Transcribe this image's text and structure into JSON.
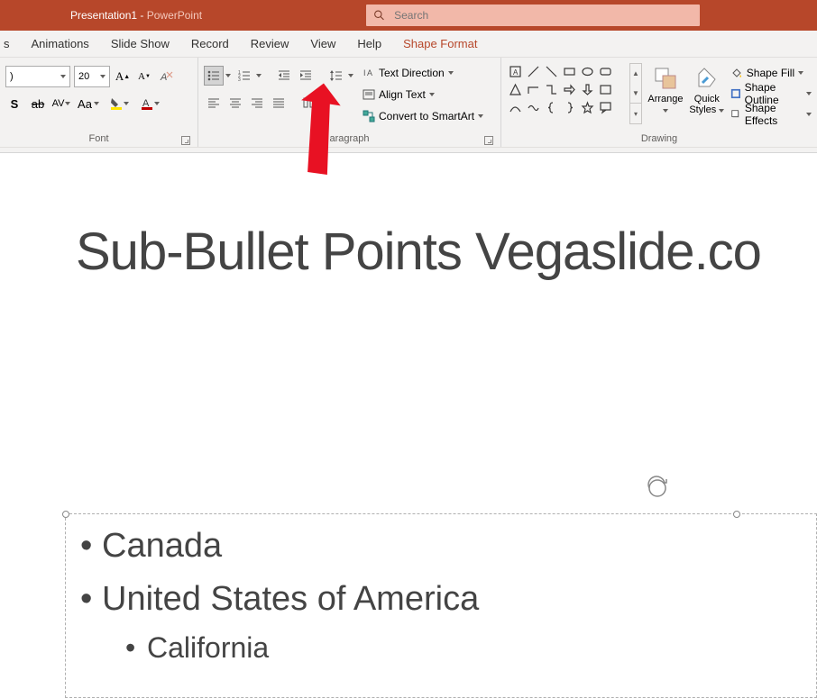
{
  "titlebar": {
    "doc": "Presentation1",
    "sep": " - ",
    "app": "PowerPoint"
  },
  "search": {
    "placeholder": "Search"
  },
  "tabs": {
    "edge": "s",
    "animations": "Animations",
    "slideshow": "Slide Show",
    "record": "Record",
    "review": "Review",
    "view": "View",
    "help": "Help",
    "shape_format": "Shape Format"
  },
  "font": {
    "family_trunc": ")",
    "size": "20",
    "group_label": "Font"
  },
  "paragraph": {
    "text_direction": "Text Direction",
    "align_text": "Align Text",
    "convert_smartart": "Convert to SmartArt",
    "group_label": "aragraph"
  },
  "drawing": {
    "arrange": "Arrange",
    "quick": "Quick",
    "styles": "Styles",
    "shape_fill": "Shape Fill",
    "shape_outline": "Shape Outline",
    "shape_effects": "Shape Effects",
    "group_label": "Drawing"
  },
  "slide": {
    "title": "Sub-Bullet Points Vegaslide.co",
    "bullets": {
      "b1": "Canada",
      "b2": "United States of America",
      "b3": "California"
    }
  },
  "chart_data": null
}
